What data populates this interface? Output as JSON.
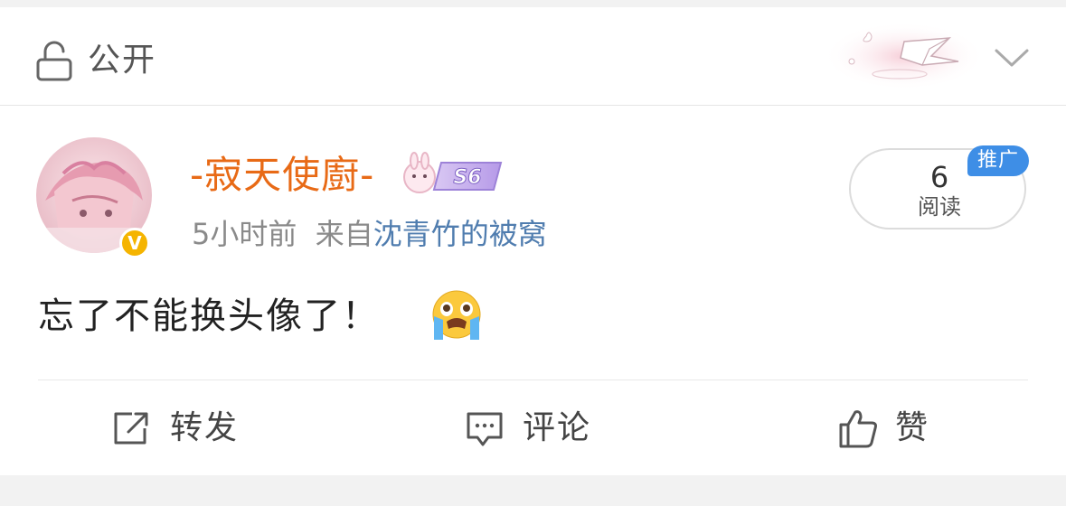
{
  "visibility": {
    "icon": "unlock-icon",
    "label": "公开"
  },
  "post": {
    "author": {
      "name": "-寂天使廚-",
      "level_badge": "S6",
      "verified_icon": "verified-v-icon",
      "verified_label": "V"
    },
    "time": "5小时前",
    "source_prefix": "来自",
    "source_link": "沈青竹的被窝",
    "text": "忘了不能换头像了！",
    "emoji": "crying-emoji"
  },
  "read_stats": {
    "count": "6",
    "label": "阅读",
    "promo_badge": "推广"
  },
  "actions": {
    "forward": {
      "icon": "share-icon",
      "label": "转发"
    },
    "comment": {
      "icon": "comment-icon",
      "label": "评论"
    },
    "like": {
      "icon": "thumbs-up-icon",
      "label": "赞"
    }
  },
  "colors": {
    "username": "#e86a16",
    "link": "#507daf",
    "promo": "#3e8ee6",
    "verified": "#f5b400"
  }
}
